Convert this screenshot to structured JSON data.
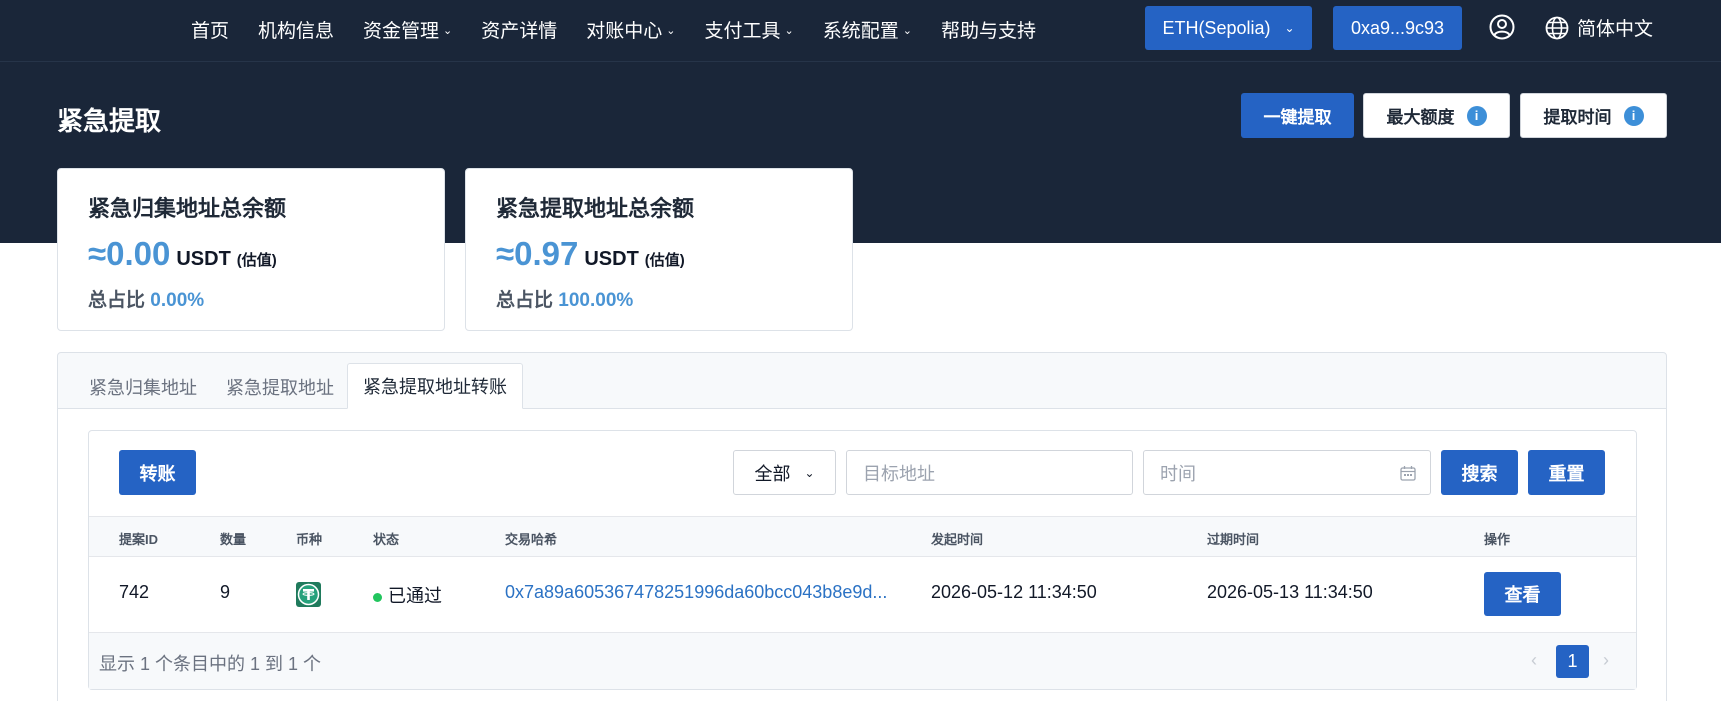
{
  "nav": {
    "items": [
      {
        "label": "首页",
        "dropdown": false
      },
      {
        "label": "机构信息",
        "dropdown": false
      },
      {
        "label": "资金管理",
        "dropdown": true
      },
      {
        "label": "资产详情",
        "dropdown": false
      },
      {
        "label": "对账中心",
        "dropdown": true
      },
      {
        "label": "支付工具",
        "dropdown": true
      },
      {
        "label": "系统配置",
        "dropdown": true
      },
      {
        "label": "帮助与支持",
        "dropdown": false
      }
    ],
    "network": "ETH(Sepolia)",
    "account": "0xa9...9c93",
    "language": "简体中文"
  },
  "header": {
    "title": "紧急提取",
    "btn_extract": "一键提取",
    "btn_max": "最大额度",
    "btn_time": "提取时间"
  },
  "cards": [
    {
      "title": "紧急归集地址总余额",
      "value": "≈0.00",
      "unit": "USDT",
      "note": "(估值)",
      "ratio_label": "总占比",
      "ratio": "0.00%"
    },
    {
      "title": "紧急提取地址总余额",
      "value": "≈0.97",
      "unit": "USDT",
      "note": "(估值)",
      "ratio_label": "总占比",
      "ratio": "100.00%"
    }
  ],
  "tabs": [
    {
      "label": "紧急归集地址",
      "active": false
    },
    {
      "label": "紧急提取地址",
      "active": false
    },
    {
      "label": "紧急提取地址转账",
      "active": true
    }
  ],
  "toolbar": {
    "transfer": "转账",
    "filter_selected": "全部",
    "address_placeholder": "目标地址",
    "time_placeholder": "时间",
    "search": "搜索",
    "reset": "重置"
  },
  "table": {
    "columns": [
      "提案ID",
      "数量",
      "币种",
      "状态",
      "交易哈希",
      "发起时间",
      "过期时间",
      "操作"
    ],
    "rows": [
      {
        "id": "742",
        "amount": "9",
        "coin_icon": "usdt-icon",
        "status": "已通过",
        "hash": "0x7a89a605367478251996da60bcc043b8e9d...",
        "created": "2026-05-12 11:34:50",
        "expires": "2026-05-13 11:34:50",
        "action": "查看"
      }
    ]
  },
  "footer": {
    "summary": "显示 1 个条目中的 1 到 1 个",
    "page": "1",
    "prev": "‹",
    "next": "›"
  },
  "colors": {
    "nav_bg": "#1a2639",
    "primary": "#2563c4",
    "accent_value": "#4a94d4",
    "status_ok": "#22c55e"
  }
}
